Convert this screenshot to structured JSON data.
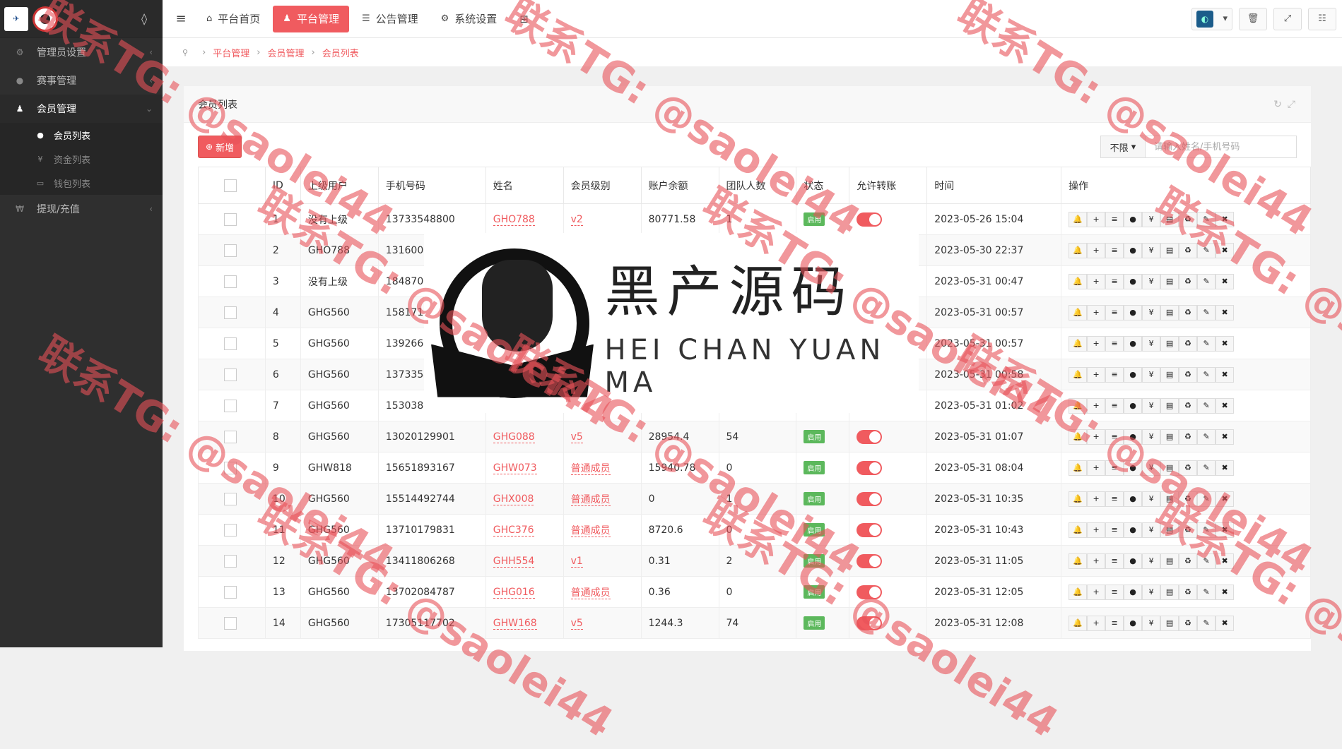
{
  "sidebar": {
    "items": [
      {
        "label": "管理员设置",
        "icon": "users-cog-icon"
      },
      {
        "label": "赛事管理",
        "icon": "group-icon"
      },
      {
        "label": "会员管理",
        "icon": "user-tie-icon"
      },
      {
        "label": "提现/充值",
        "icon": "won-icon"
      }
    ],
    "sub_items": [
      {
        "label": "会员列表",
        "icon": "users-icon"
      },
      {
        "label": "资金列表",
        "icon": "yen-icon"
      },
      {
        "label": "钱包列表",
        "icon": "wallet-icon"
      }
    ]
  },
  "topbar": {
    "tabs": [
      {
        "label": "平台首页",
        "icon": "home-icon"
      },
      {
        "label": "平台管理",
        "icon": "user-icon"
      },
      {
        "label": "公告管理",
        "icon": "list-icon"
      },
      {
        "label": "系统设置",
        "icon": "gear-icon"
      }
    ]
  },
  "breadcrumb": {
    "items": [
      "平台管理",
      "会员管理",
      "会员列表"
    ]
  },
  "panel": {
    "title": "会员列表"
  },
  "toolbar": {
    "add_label": "新增",
    "filter_value": "不限",
    "search_placeholder": "请输入姓名/手机号码"
  },
  "table": {
    "headers": [
      "",
      "ID",
      "上级用户",
      "手机号码",
      "姓名",
      "会员级别",
      "账户余额",
      "团队人数",
      "状态",
      "允许转账",
      "时间",
      "操作"
    ],
    "status_label": "启用",
    "rows": [
      {
        "id": "1",
        "parent": "没有上级",
        "phone": "13733548800",
        "name": "GHO788",
        "level": "v2",
        "balance": "80771.58",
        "team": "1",
        "time": "2023-05-26 15:04"
      },
      {
        "id": "2",
        "parent": "GHO788",
        "phone": "13160023",
        "name": "",
        "level": "",
        "balance": "",
        "team": "",
        "time": "2023-05-30 22:37"
      },
      {
        "id": "3",
        "parent": "没有上级",
        "phone": "18487095",
        "name": "",
        "level": "",
        "balance": "",
        "team": "",
        "time": "2023-05-31 00:47"
      },
      {
        "id": "4",
        "parent": "GHG560",
        "phone": "15817123",
        "name": "",
        "level": "",
        "balance": "",
        "team": "",
        "time": "2023-05-31 00:57"
      },
      {
        "id": "5",
        "parent": "GHG560",
        "phone": "13926693",
        "name": "",
        "level": "",
        "balance": "",
        "team": "",
        "time": "2023-05-31 00:57"
      },
      {
        "id": "6",
        "parent": "GHG560",
        "phone": "13733541",
        "name": "",
        "level": "",
        "balance": "",
        "team": "",
        "time": "2023-05-31 00:58"
      },
      {
        "id": "7",
        "parent": "GHG560",
        "phone": "15303891",
        "name": "",
        "level": "",
        "balance": "",
        "team": "",
        "time": "2023-05-31 01:02"
      },
      {
        "id": "8",
        "parent": "GHG560",
        "phone": "13020129901",
        "name": "GHG088",
        "level": "v5",
        "balance": "28954.4",
        "team": "54",
        "time": "2023-05-31 01:07"
      },
      {
        "id": "9",
        "parent": "GHW818",
        "phone": "15651893167",
        "name": "GHW073",
        "level": "普通成员",
        "balance": "15940.78",
        "team": "0",
        "time": "2023-05-31 08:04"
      },
      {
        "id": "10",
        "parent": "GHG560",
        "phone": "15514492744",
        "name": "GHX008",
        "level": "普通成员",
        "balance": "0",
        "team": "1",
        "time": "2023-05-31 10:35"
      },
      {
        "id": "11",
        "parent": "GHG560",
        "phone": "13710179831",
        "name": "GHC376",
        "level": "普通成员",
        "balance": "8720.6",
        "team": "0",
        "time": "2023-05-31 10:43"
      },
      {
        "id": "12",
        "parent": "GHG560",
        "phone": "13411806268",
        "name": "GHH554",
        "level": "v1",
        "balance": "0.31",
        "team": "2",
        "time": "2023-05-31 11:05"
      },
      {
        "id": "13",
        "parent": "GHG560",
        "phone": "13702084787",
        "name": "GHG016",
        "level": "普通成员",
        "balance": "0.36",
        "team": "0",
        "time": "2023-05-31 12:05"
      },
      {
        "id": "14",
        "parent": "GHG560",
        "phone": "17305117702",
        "name": "GHW168",
        "level": "v5",
        "balance": "1244.3",
        "team": "74",
        "time": "2023-05-31 12:08"
      }
    ],
    "op_icons": [
      "bell-icon",
      "plus-icon",
      "list-icon",
      "team-icon",
      "yen-icon",
      "card-icon",
      "recycle-icon",
      "edit-icon",
      "delete-icon"
    ]
  },
  "overlay": {
    "title_cn": "黑产源码",
    "title_en": "HEI CHAN YUAN MA"
  },
  "watermark": {
    "text": "联系TG: @saolei44"
  },
  "colors": {
    "accent": "#f05b5f",
    "sidebar": "#2f2f2f",
    "status_green": "#5cb85c"
  }
}
